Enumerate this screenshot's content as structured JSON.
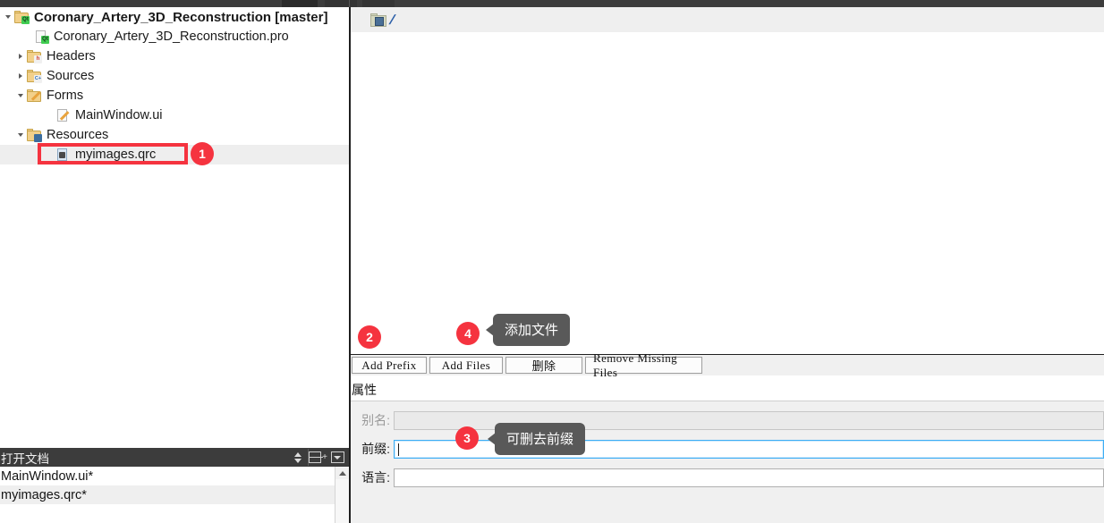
{
  "sidebar": {
    "tree": [
      {
        "label": "Coronary_Artery_3D_Reconstruction [master]",
        "icon": "qt-project-folder-icon",
        "arrow": "open",
        "indent": 0,
        "bold": true,
        "selected": false
      },
      {
        "label": "Coronary_Artery_3D_Reconstruction.pro",
        "icon": "qt-pro-file-icon",
        "arrow": "none",
        "indent": 1,
        "bold": false,
        "selected": false
      },
      {
        "label": "Headers",
        "icon": "headers-folder-icon",
        "arrow": "closed",
        "indent": 1,
        "bold": false,
        "selected": false
      },
      {
        "label": "Sources",
        "icon": "sources-folder-icon",
        "arrow": "closed",
        "indent": 1,
        "bold": false,
        "selected": false
      },
      {
        "label": "Forms",
        "icon": "forms-folder-icon",
        "arrow": "open",
        "indent": 1,
        "bold": false,
        "selected": false
      },
      {
        "label": "MainWindow.ui",
        "icon": "ui-file-icon",
        "arrow": "none",
        "indent": 2,
        "bold": false,
        "selected": false
      },
      {
        "label": "Resources",
        "icon": "resources-folder-icon",
        "arrow": "open",
        "indent": 1,
        "bold": false,
        "selected": false
      },
      {
        "label": "myimages.qrc",
        "icon": "qrc-file-icon",
        "arrow": "none",
        "indent": 2,
        "bold": false,
        "selected": true
      }
    ]
  },
  "open_documents": {
    "title": "打开文档",
    "controls": {
      "sort": "sort-updown-icon",
      "split": "split-view-icon",
      "menu": "dropdown-menu-icon"
    },
    "items": [
      {
        "label": "MainWindow.ui*"
      },
      {
        "label": "myimages.qrc*"
      }
    ]
  },
  "qrc_editor": {
    "root_node": "/",
    "root_icon": "qrc-prefix-folder-icon",
    "buttons": [
      {
        "label": "Add Prefix"
      },
      {
        "label": "Add Files"
      },
      {
        "label": "删除"
      },
      {
        "label": "Remove Missing Files"
      }
    ],
    "properties_title": "属性",
    "fields": [
      {
        "label": "别名:",
        "value": "",
        "disabled": true,
        "focused": false
      },
      {
        "label": "前缀:",
        "value": "",
        "disabled": false,
        "focused": true
      },
      {
        "label": "语言:",
        "value": "",
        "disabled": false,
        "focused": false
      }
    ]
  },
  "annotations": {
    "badges": [
      {
        "number": "1"
      },
      {
        "number": "2"
      },
      {
        "number": "3"
      },
      {
        "number": "4"
      }
    ],
    "callouts": [
      {
        "text": "添加文件"
      },
      {
        "text": "可删去前缀"
      }
    ],
    "highlight_color": "#f5333f"
  }
}
